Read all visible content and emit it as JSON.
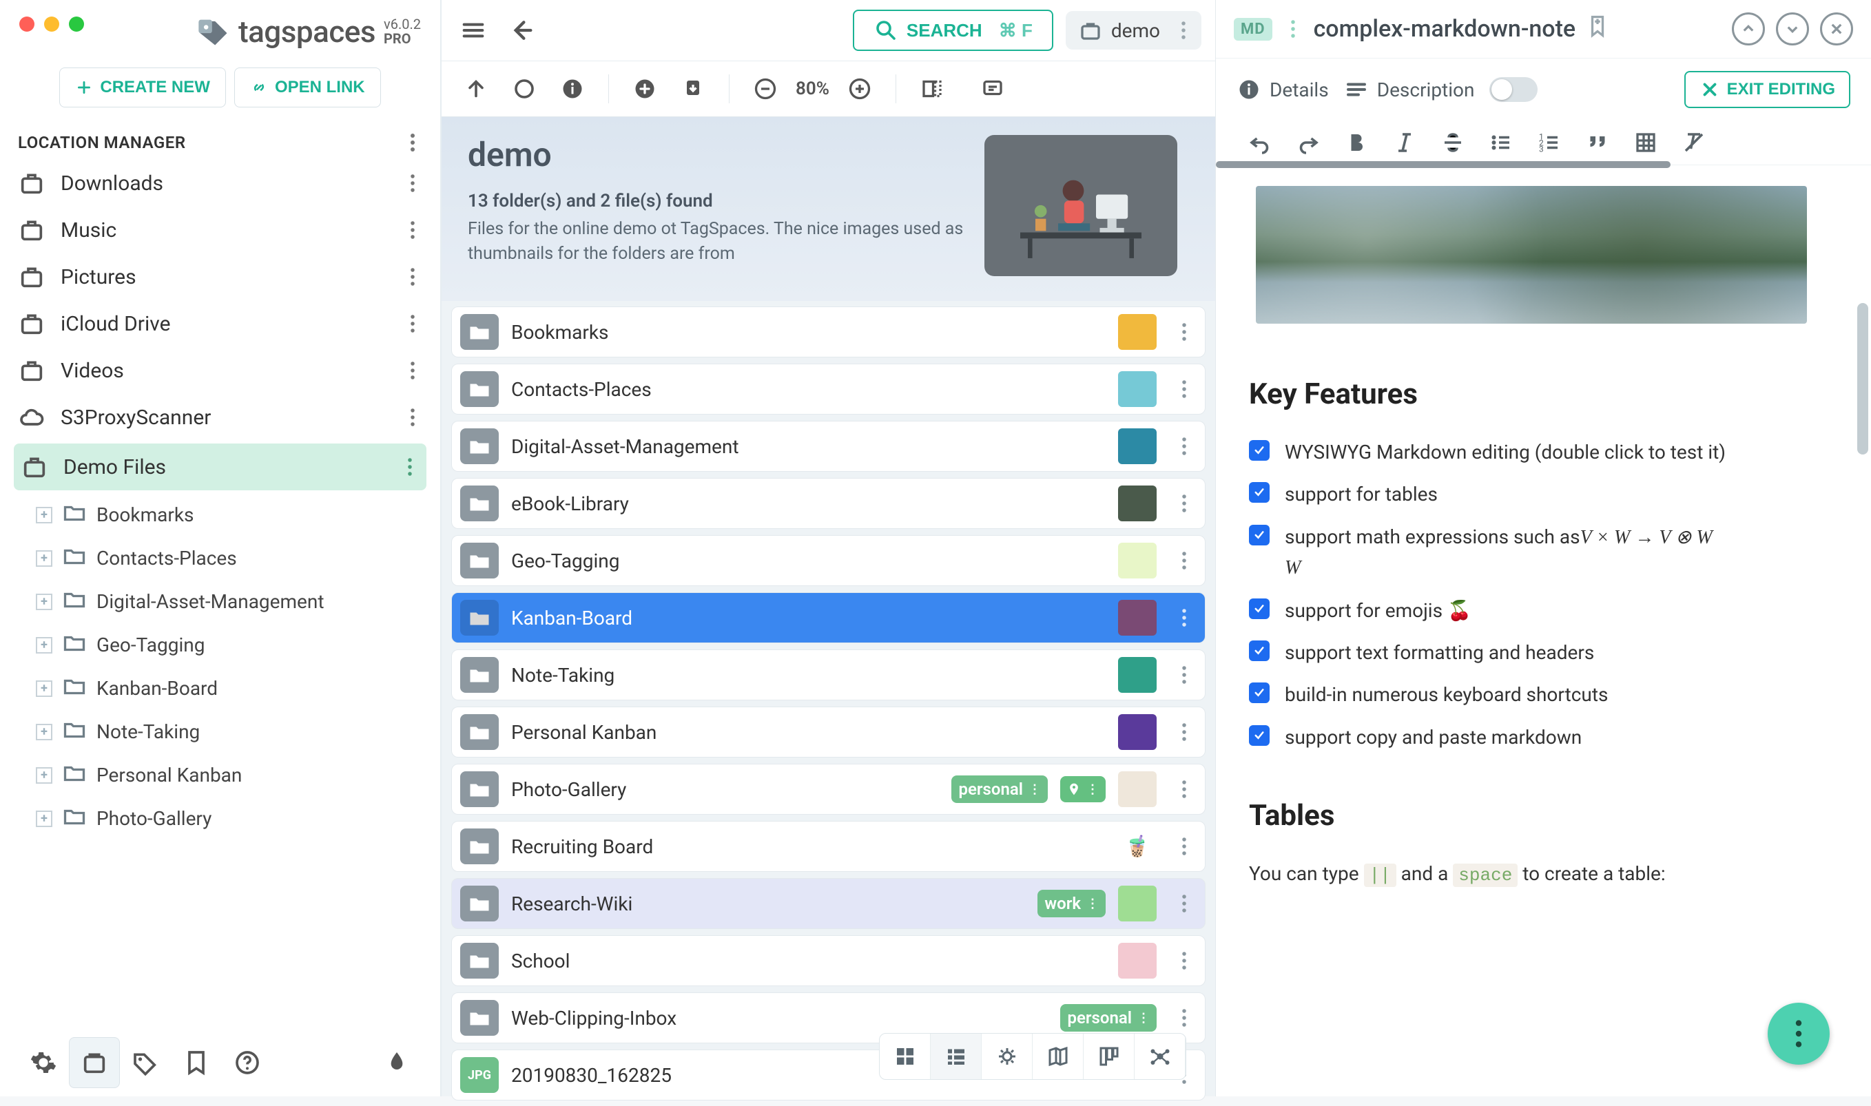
{
  "app": {
    "name": "tagspaces",
    "version": "v6.0.2",
    "edition": "PRO"
  },
  "sidebar": {
    "create_label": "CREATE NEW",
    "open_link_label": "OPEN LINK",
    "section_title": "LOCATION MANAGER",
    "locations": [
      {
        "label": "Downloads",
        "icon": "briefcase"
      },
      {
        "label": "Music",
        "icon": "briefcase"
      },
      {
        "label": "Pictures",
        "icon": "briefcase"
      },
      {
        "label": "iCloud Drive",
        "icon": "briefcase"
      },
      {
        "label": "Videos",
        "icon": "briefcase"
      },
      {
        "label": "S3ProxyScanner",
        "icon": "cloud"
      },
      {
        "label": "Demo Files",
        "icon": "briefcase",
        "active": true
      }
    ],
    "tree": [
      "Bookmarks",
      "Contacts-Places",
      "Digital-Asset-Management",
      "Geo-Tagging",
      "Kanban-Board",
      "Note-Taking",
      "Personal Kanban",
      "Photo-Gallery"
    ]
  },
  "topbar": {
    "search_label": "SEARCH",
    "search_shortcut": "⌘ F",
    "location_chip": "demo",
    "zoom": "80%"
  },
  "hero": {
    "title": "demo",
    "sub1": "13 folder(s) and 2 file(s) found",
    "sub2": "Files for the online demo ot TagSpaces. The nice images used as thumbnails for the folders are from"
  },
  "rows": [
    {
      "name": "Bookmarks",
      "thumb_bg": "#f1b93d"
    },
    {
      "name": "Contacts-Places",
      "thumb_bg": "#76c9d6"
    },
    {
      "name": "Digital-Asset-Management",
      "thumb_bg": "#2c8aa5"
    },
    {
      "name": "eBook-Library",
      "thumb_bg": "#4a5a4b"
    },
    {
      "name": "Geo-Tagging",
      "thumb_bg": "#e8f6c8"
    },
    {
      "name": "Kanban-Board",
      "thumb_bg": "#7a4a74",
      "selected": true
    },
    {
      "name": "Note-Taking",
      "thumb_bg": "#2fa089"
    },
    {
      "name": "Personal Kanban",
      "thumb_bg": "#5a3a9b"
    },
    {
      "name": "Photo-Gallery",
      "thumb_bg": "#efe7db",
      "tags": [
        {
          "text": "personal",
          "type": "text"
        },
        {
          "type": "geo"
        }
      ]
    },
    {
      "name": "Recruiting Board",
      "thumb_bg": "#ffffff",
      "thumb_emoji": "🧋"
    },
    {
      "name": "Research-Wiki",
      "thumb_bg": "#9fdd93",
      "alt": true,
      "tags": [
        {
          "text": "work",
          "type": "text"
        }
      ]
    },
    {
      "name": "School",
      "thumb_bg": "#f3c9d1"
    },
    {
      "name": "Web-Clipping-Inbox",
      "tags": [
        {
          "text": "personal",
          "type": "text"
        }
      ]
    },
    {
      "name": "20190830_162825",
      "file": true,
      "ext": "JPG"
    }
  ],
  "right": {
    "badge": "MD",
    "title": "complex-markdown-note",
    "details_label": "Details",
    "description_label": "Description",
    "exit_label": "EXIT EDITING",
    "h_features": "Key Features",
    "features": [
      "WYSIWYG Markdown editing (double click to test it)",
      "support for tables",
      "support math expressions such as",
      "support for emojis 🍒",
      "support text formatting and headers",
      "build-in numerous keyboard shortcuts",
      "support copy and paste markdown"
    ],
    "math_expr": "V × W → V ⊗ W",
    "h_tables": "Tables",
    "tables_p_prefix": "You can type ",
    "tables_p_kbd1": "||",
    "tables_p_mid": " and a ",
    "tables_p_kbd2": "space",
    "tables_p_suffix": " to create a table:"
  }
}
